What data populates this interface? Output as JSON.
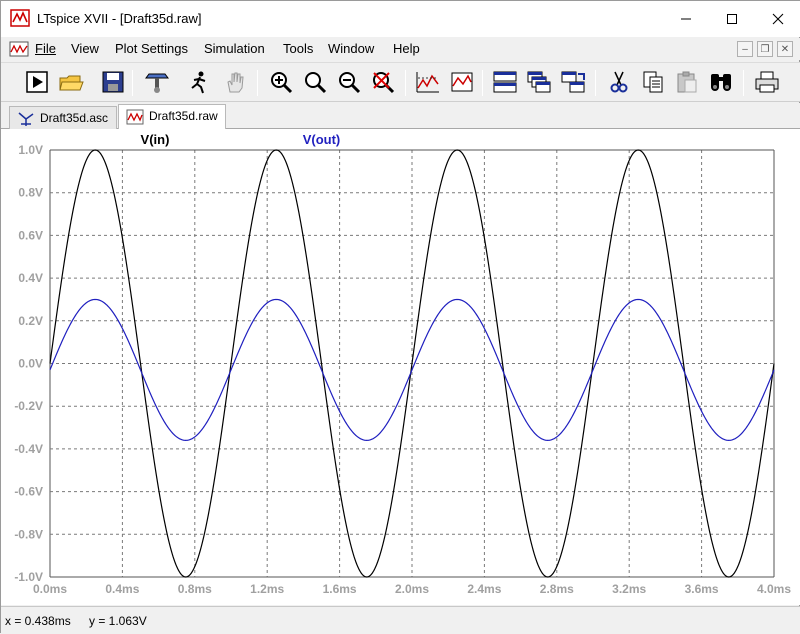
{
  "window": {
    "title": "LTspice XVII - [Draft35d.raw]"
  },
  "menu": [
    {
      "label": "File"
    },
    {
      "label": "View"
    },
    {
      "label": "Plot Settings"
    },
    {
      "label": "Simulation"
    },
    {
      "label": "Tools"
    },
    {
      "label": "Window"
    },
    {
      "label": "Help"
    }
  ],
  "tabs": [
    {
      "label": "Draft35d.asc",
      "icon": "schematic-icon"
    },
    {
      "label": "Draft35d.raw",
      "icon": "waveform-icon"
    }
  ],
  "toolbar": {
    "icons": [
      "run-icon",
      "open-icon",
      "save-icon",
      "control-panel-icon",
      "run-halt-icon",
      "pan-hand-icon",
      "zoom-in-icon",
      "zoom-area-icon",
      "zoom-out-icon",
      "zoom-cancel-icon",
      "autorange-icon",
      "fit-icon",
      "tile-horizontal-icon",
      "cascade-icon",
      "tile-vertical-icon",
      "cut-icon",
      "copy-icon",
      "paste-icon",
      "find-icon",
      "print-icon"
    ]
  },
  "status": {
    "x_text": "x = 0.438ms",
    "y_text": "y = 1.063V"
  },
  "colors": {
    "vin": "#000000",
    "vout": "#1f1fbf",
    "grid": "#7a7a7a",
    "tick_label": "#a0a0a0"
  },
  "chart_data": {
    "type": "line",
    "x_unit": "ms",
    "xlim": [
      0.0,
      4.0
    ],
    "ylim": [
      -1.0,
      1.0
    ],
    "grid": true,
    "x_ticks": [
      "0.0ms",
      "0.4ms",
      "0.8ms",
      "1.2ms",
      "1.6ms",
      "2.0ms",
      "2.4ms",
      "2.8ms",
      "3.2ms",
      "3.6ms",
      "4.0ms"
    ],
    "y_ticks": [
      "1.0V",
      "0.8V",
      "0.6V",
      "0.4V",
      "0.2V",
      "0.0V",
      "-0.2V",
      "-0.4V",
      "-0.6V",
      "-0.8V",
      "-1.0V"
    ],
    "series": [
      {
        "name": "V(in)",
        "amplitude": 1.0,
        "offset": 0.0,
        "frequency_khz": 1.0,
        "shape": "sine"
      },
      {
        "name": "V(out)",
        "amplitude": 0.33,
        "offset": -0.03,
        "frequency_khz": 1.0,
        "shape": "sine"
      }
    ]
  }
}
